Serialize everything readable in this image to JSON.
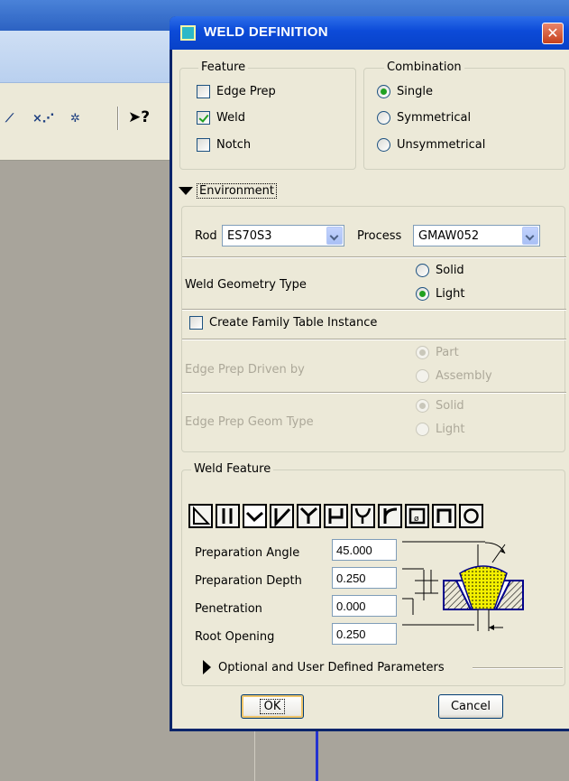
{
  "dialog": {
    "title": "WELD DEFINITION",
    "close_glyph": "✕"
  },
  "feature": {
    "label": "Feature",
    "items": [
      {
        "label": "Edge Prep",
        "checked": false
      },
      {
        "label": "Weld",
        "checked": true
      },
      {
        "label": "Notch",
        "checked": false
      }
    ]
  },
  "combination": {
    "label": "Combination",
    "items": [
      {
        "label": "Single",
        "selected": true
      },
      {
        "label": "Symmetrical",
        "selected": false
      },
      {
        "label": "Unsymmetrical",
        "selected": false
      }
    ]
  },
  "environment": {
    "label": "Environment",
    "rod_label": "Rod",
    "rod_value": "ES70S3",
    "process_label": "Process",
    "process_value": "GMAW052",
    "geometry_type_label": "Weld Geometry Type",
    "geometry_options": [
      "Solid",
      "Light"
    ],
    "geometry_selected": "Light",
    "family_table_label": "Create Family Table Instance",
    "family_table_checked": false,
    "edge_prep_driven_label": "Edge Prep Driven by",
    "edge_prep_driven_options": [
      "Part",
      "Assembly"
    ],
    "edge_prep_geom_label": "Edge Prep Geom Type",
    "edge_prep_geom_options": [
      "Solid",
      "Light"
    ]
  },
  "weld_feature": {
    "label": "Weld Feature",
    "type_buttons": [
      "square-edge-icon",
      "double-bar-icon",
      "v-groove-icon",
      "bevel-icon",
      "y-groove-icon",
      "bevel-j-icon",
      "u-groove-icon",
      "j-groove-icon",
      "plug-icon",
      "slot-icon",
      "spot-icon"
    ],
    "selected_type": "v-groove-icon",
    "fields": [
      {
        "label": "Preparation Angle",
        "value": "45.000"
      },
      {
        "label": "Preparation Depth",
        "value": "0.250"
      },
      {
        "label": "Penetration",
        "value": "0.000"
      },
      {
        "label": "Root Opening",
        "value": "0.250"
      }
    ],
    "optional_label": "Optional and User Defined Parameters"
  },
  "buttons": {
    "ok": "OK",
    "cancel": "Cancel"
  },
  "toolbar": {
    "help_glyph": "➤?"
  }
}
